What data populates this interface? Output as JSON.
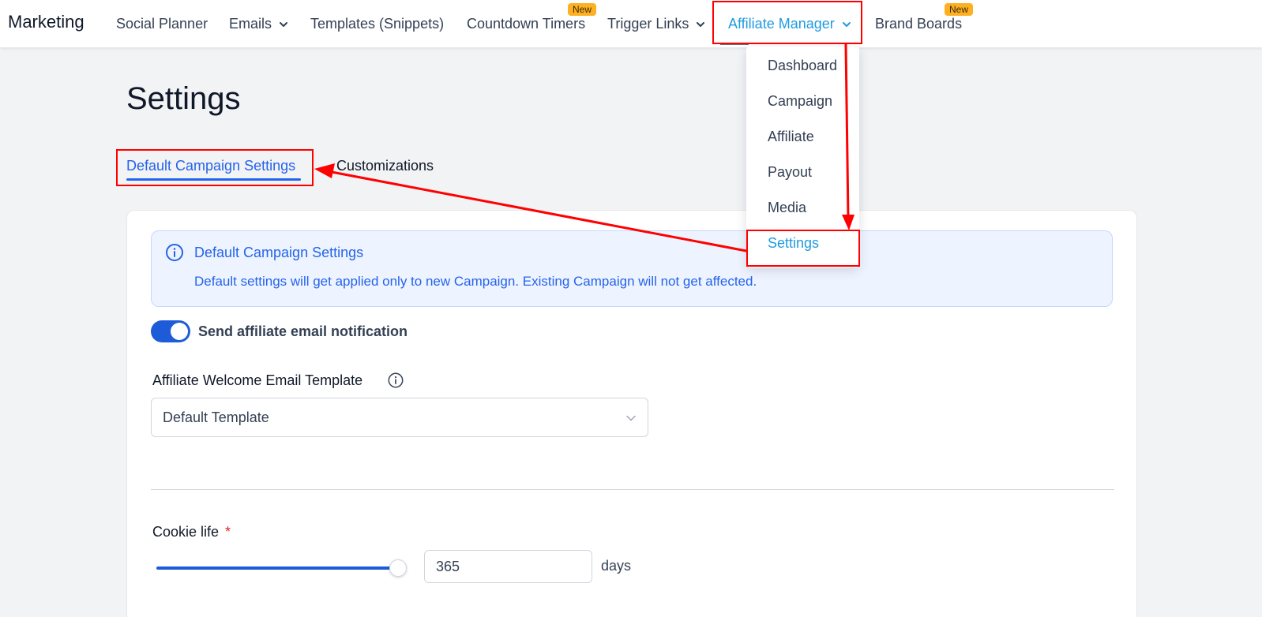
{
  "nav": {
    "brand": "Marketing",
    "items": [
      {
        "label": "Social Planner"
      },
      {
        "label": "Emails"
      },
      {
        "label": "Templates (Snippets)"
      },
      {
        "label": "Countdown Timers",
        "badge": "New"
      },
      {
        "label": "Trigger Links"
      },
      {
        "label": "Affiliate Manager"
      },
      {
        "label": "Brand Boards",
        "badge": "New"
      }
    ],
    "active": "Affiliate Manager"
  },
  "dropdown": {
    "items": [
      "Dashboard",
      "Campaign",
      "Affiliate",
      "Payout",
      "Media",
      "Settings"
    ],
    "selected": "Settings"
  },
  "page": {
    "title": "Settings",
    "tabs": [
      "Default Campaign Settings",
      "Customizations"
    ],
    "active_tab": "Default Campaign Settings"
  },
  "info": {
    "title": "Default Campaign Settings",
    "text": "Default settings will get applied only to new Campaign. Existing Campaign will not get affected."
  },
  "notification": {
    "label": "Send affiliate email notification",
    "enabled": true
  },
  "welcome_template": {
    "label": "Affiliate Welcome Email Template",
    "value": "Default Template"
  },
  "cookie": {
    "label": "Cookie life",
    "required_mark": "*",
    "value": "365",
    "unit": "days"
  },
  "colors": {
    "accent": "#2563eb",
    "nav_active": "#1e9be0",
    "annotation": "#ff0000",
    "badge": "#fdb022"
  }
}
